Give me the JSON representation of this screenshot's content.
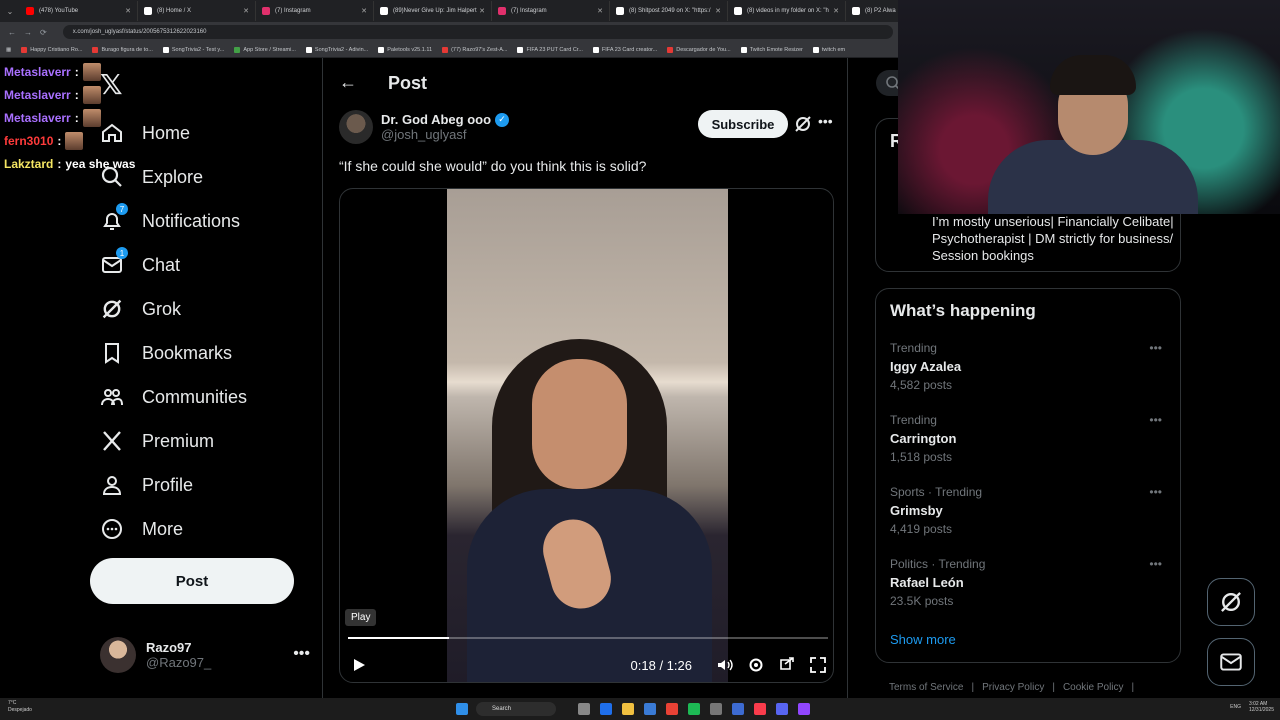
{
  "browser": {
    "tabs": [
      {
        "label": "(478) YouTube",
        "color": "#ff0000"
      },
      {
        "label": "(8) Home / X",
        "color": "#ffffff"
      },
      {
        "label": "(7) Instagram",
        "color": "#e1306c"
      },
      {
        "label": "(89)Never Give Up: Jim Halpert",
        "color": "#ffffff"
      },
      {
        "label": "(7) Instagram",
        "color": "#e1306c"
      },
      {
        "label": "(8) Shitpost 2049 on X: \"https:/",
        "color": "#ffffff"
      },
      {
        "label": "(8) videos in my folder on X: \"h",
        "color": "#ffffff"
      },
      {
        "label": "(8) P2 Alwa",
        "color": "#ffffff"
      }
    ],
    "url": "x.com/josh_uglyasf/status/2005675312622023160",
    "bookmarks": [
      "Happy Cristiano Ro...",
      "Burago figura de to...",
      "SongTrivia2 - Test y...",
      "App Store / Streami...",
      "SongTrivia2 - Adivin...",
      "Paletools v25.1.11",
      "(77) Razo97's Zest-A...",
      "FIFA 23 PUT Card Cr...",
      "FIFA 23 Card creator...",
      "Descargador de You...",
      "Twitch Emote Resizer",
      "twitch em"
    ]
  },
  "chat": [
    {
      "user": "Metaslaverr",
      "color": "#a970ff",
      "message": "",
      "avatar": true
    },
    {
      "user": "Metaslaverr",
      "color": "#a970ff",
      "message": "",
      "avatar": true
    },
    {
      "user": "Metaslaverr",
      "color": "#a970ff",
      "message": "",
      "avatar": true
    },
    {
      "user": "fern3010",
      "color": "#ff3b3b",
      "message": "",
      "avatar": true
    },
    {
      "user": "Lakztard",
      "color": "#f5e663",
      "message": "yea she was",
      "avatar": false
    }
  ],
  "nav": {
    "items": [
      {
        "label": "Home",
        "icon": "home-icon",
        "badge": ""
      },
      {
        "label": "Explore",
        "icon": "search-icon",
        "badge": ""
      },
      {
        "label": "Notifications",
        "icon": "bell-icon",
        "badge": "7"
      },
      {
        "label": "Chat",
        "icon": "mail-icon",
        "badge": "1"
      },
      {
        "label": "Grok",
        "icon": "grok-icon",
        "badge": ""
      },
      {
        "label": "Bookmarks",
        "icon": "bookmark-icon",
        "badge": ""
      },
      {
        "label": "Communities",
        "icon": "people-icon",
        "badge": ""
      },
      {
        "label": "Premium",
        "icon": "x-icon",
        "badge": ""
      },
      {
        "label": "Profile",
        "icon": "person-icon",
        "badge": ""
      },
      {
        "label": "More",
        "icon": "more-circle-icon",
        "badge": ""
      }
    ],
    "post_label": "Post",
    "account": {
      "name": "Razo97",
      "handle": "@Razo97_"
    }
  },
  "main": {
    "title": "Post",
    "author": {
      "name": "Dr. God Abeg ooo",
      "handle": "@josh_uglyasf"
    },
    "subscribe_label": "Subscribe",
    "text": "“If she could she would” do you think this is solid?",
    "video": {
      "tooltip": "Play",
      "time": "0:18 / 1:26",
      "progress": 0.21
    }
  },
  "right": {
    "card_letter": "R",
    "bio": "I’m mostly unserious| Financially Celibate| Psychotherapist | DM strictly for business/ Session bookings",
    "happening_title": "What’s happening",
    "trends": [
      {
        "meta": "Trending",
        "name": "Iggy Azalea",
        "count": "4,582 posts"
      },
      {
        "meta": "Trending",
        "name": "Carrington",
        "count": "1,518 posts"
      },
      {
        "meta": "Sports · Trending",
        "name": "Grimsby",
        "count": "4,419 posts"
      },
      {
        "meta": "Politics · Trending",
        "name": "Rafael León",
        "count": "23.5K posts"
      }
    ],
    "show_more": "Show more",
    "footer": [
      "Terms of Service",
      "|",
      "Privacy Policy",
      "|",
      "Cookie Policy",
      "|"
    ]
  },
  "taskbar": {
    "weather_temp": "7°C",
    "weather_desc": "Despejado",
    "search": "Search",
    "lang": "ENG",
    "time": "3:02 AM",
    "date": "12/31/2025"
  },
  "colors": {
    "accent": "#1d9bf0",
    "background": "#000000",
    "border": "#2f3336",
    "muted": "#71767b"
  }
}
